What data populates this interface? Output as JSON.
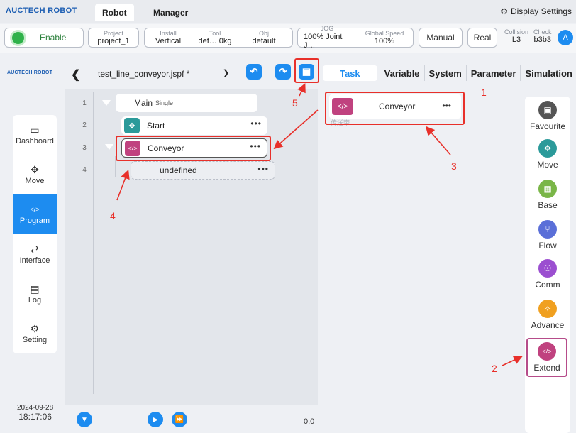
{
  "topbar": {
    "brand": "AUCTECH ROBOT",
    "tabs": [
      {
        "label": "Robot",
        "active": true
      },
      {
        "label": "Manager",
        "active": false
      }
    ],
    "display_settings": "Display Settings"
  },
  "status": {
    "enable": "Enable",
    "project_label": "Project",
    "project_value": "project_1",
    "install_label": "Install",
    "install_value": "Vertical",
    "tool_label": "Tool",
    "tool_value": "def… 0kg",
    "obj_label": "Obj",
    "obj_value": "default",
    "jog_label": "JOG",
    "jog_value": "100% Joint J…",
    "speed_label": "Global Speed",
    "speed_value": "100%",
    "manual": "Manual",
    "real": "Real",
    "collision_label": "Collision",
    "collision_value": "L3",
    "check_label": "Check",
    "check_value": "b3b3",
    "avatar": "A"
  },
  "sidebar": {
    "brand": "AUCTECH ROBOT",
    "items": [
      {
        "label": "Dashboard",
        "icon": "▭"
      },
      {
        "label": "Move",
        "icon": "✥"
      },
      {
        "label": "Program",
        "icon": "</>"
      },
      {
        "label": "Interface",
        "icon": "⇄"
      },
      {
        "label": "Log",
        "icon": "▤"
      },
      {
        "label": "Setting",
        "icon": "⚙"
      }
    ],
    "date": "2024-09-28",
    "time": "18:17:06"
  },
  "editor": {
    "file_name": "test_line_conveyor.jspf *",
    "lines": [
      "1",
      "2",
      "3",
      "4"
    ],
    "main_label": "Main",
    "main_sub": "Single",
    "start_label": "Start",
    "conveyor_label": "Conveyor",
    "undefined_label": "undefined",
    "dots": "•••",
    "progress": "0.0"
  },
  "right": {
    "tabs": [
      "Task",
      "Variable",
      "System",
      "Parameter",
      "Simulation"
    ],
    "func_label": "Conveyor",
    "func_sub": "传送带",
    "categories": [
      {
        "label": "Favourite",
        "color": "#555555",
        "icon": "▣"
      },
      {
        "label": "Move",
        "color": "#2b9a9a",
        "icon": "✥"
      },
      {
        "label": "Base",
        "color": "#7ab648",
        "icon": "▦"
      },
      {
        "label": "Flow",
        "color": "#5a6fd8",
        "icon": "⑂"
      },
      {
        "label": "Comm",
        "color": "#9b4fd0",
        "icon": "☉"
      },
      {
        "label": "Advance",
        "color": "#f0a020",
        "icon": "✧"
      },
      {
        "label": "Extend",
        "color": "#c0427f",
        "icon": "</>"
      }
    ]
  },
  "annotations": [
    "1",
    "2",
    "3",
    "4",
    "5"
  ],
  "colors": {
    "accent": "#1d8cf0",
    "highlight": "#e8302a"
  }
}
